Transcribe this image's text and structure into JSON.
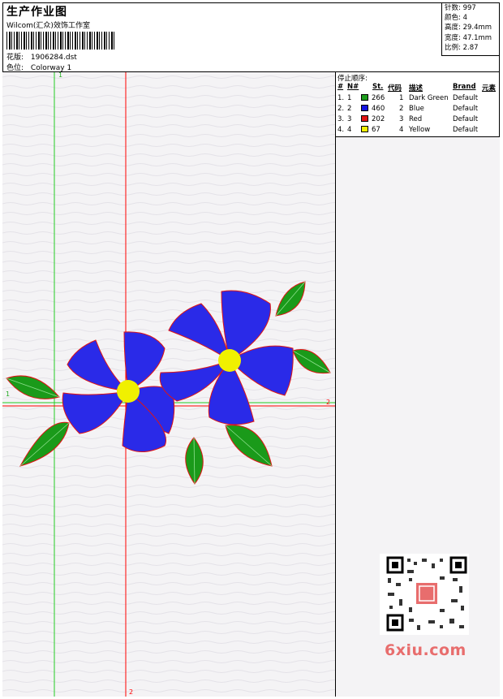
{
  "header": {
    "title": "生产作业图",
    "company": "Wilcom(汇众)效饰工作室",
    "design_label": "花版:",
    "design_value": "1906284.dst",
    "colorway_label": "色位:",
    "colorway_value": "Colorway 1"
  },
  "stats": [
    {
      "label": "针数:",
      "value": "997"
    },
    {
      "label": "颜色:",
      "value": "4"
    },
    {
      "label": "高度:",
      "value": "29.4mm"
    },
    {
      "label": "宽度:",
      "value": "47.1mm"
    },
    {
      "label": "比例:",
      "value": "2.87"
    }
  ],
  "stop_sequence": {
    "title": "停止顺序:",
    "headers": {
      "num": "#",
      "n": "N#",
      "st": "St.",
      "code": "代码",
      "desc": "描述",
      "brand": "Brand",
      "element": "元素"
    },
    "rows": [
      {
        "num": "1.",
        "n": "1",
        "color": "#1e9e1e",
        "st": "266",
        "code": "1",
        "desc": "Dark Green",
        "brand": "Default"
      },
      {
        "num": "2.",
        "n": "2",
        "color": "#1414e0",
        "st": "460",
        "code": "2",
        "desc": "Blue",
        "brand": "Default"
      },
      {
        "num": "3.",
        "n": "3",
        "color": "#e01414",
        "st": "202",
        "code": "3",
        "desc": "Red",
        "brand": "Default"
      },
      {
        "num": "4.",
        "n": "4",
        "color": "#f0f000",
        "st": "67",
        "code": "4",
        "desc": "Yellow",
        "brand": "Default"
      }
    ]
  },
  "axes": {
    "green_top": "1",
    "green_left": "1",
    "red_right": "2",
    "red_bottom": "2"
  },
  "watermark": "6xiu.com",
  "colors": {
    "green_line": "#22cc22",
    "red_line": "#ff0000",
    "leaf_fill": "#1a9a1a",
    "leaf_outline": "#e01414",
    "petal": "#1414e0",
    "center": "#f0f000"
  }
}
